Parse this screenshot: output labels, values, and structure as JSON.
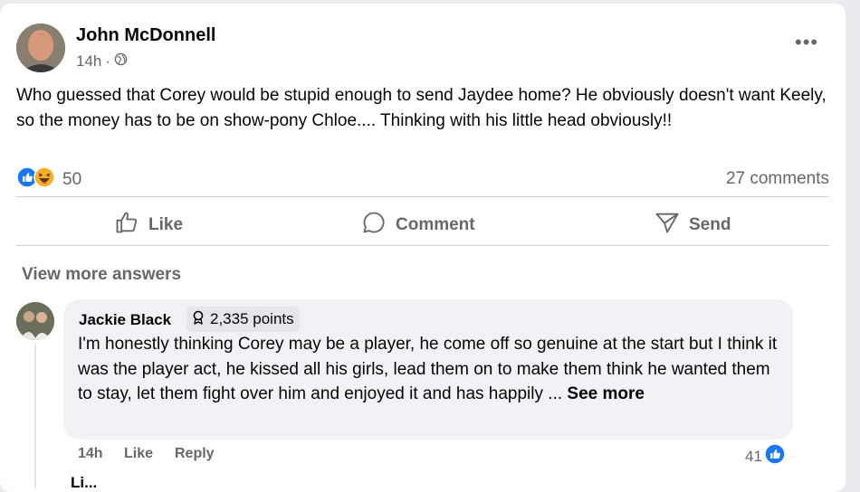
{
  "post": {
    "author": "John McDonnell",
    "time": "14h",
    "separator": "·",
    "text": "Who guessed that Corey would be stupid enough to send Jaydee home? He obviously doesn't want Keely, so the money has to be on show-pony Chloe.... Thinking with his little head obviously!!",
    "reactions": {
      "icons": [
        "like-icon",
        "haha-icon"
      ],
      "count": "50"
    },
    "comments_count": "27 comments"
  },
  "actions": {
    "like": "Like",
    "comment": "Comment",
    "send": "Send"
  },
  "view_more": "View more answers",
  "reply": {
    "author": "Jackie Black",
    "points": "2,335 points",
    "text": "I'm honestly thinking Corey may be a player, he come off so genuine at the start but I think it was the player act, he kissed all his girls, lead them on to make them think he wanted them to stay, let them fight over him and enjoyed it and has happily ...",
    "see_more": "See more",
    "time": "14h",
    "like": "Like",
    "reply_label": "Reply",
    "likes": "41"
  },
  "next_reply_partial": "Li..."
}
